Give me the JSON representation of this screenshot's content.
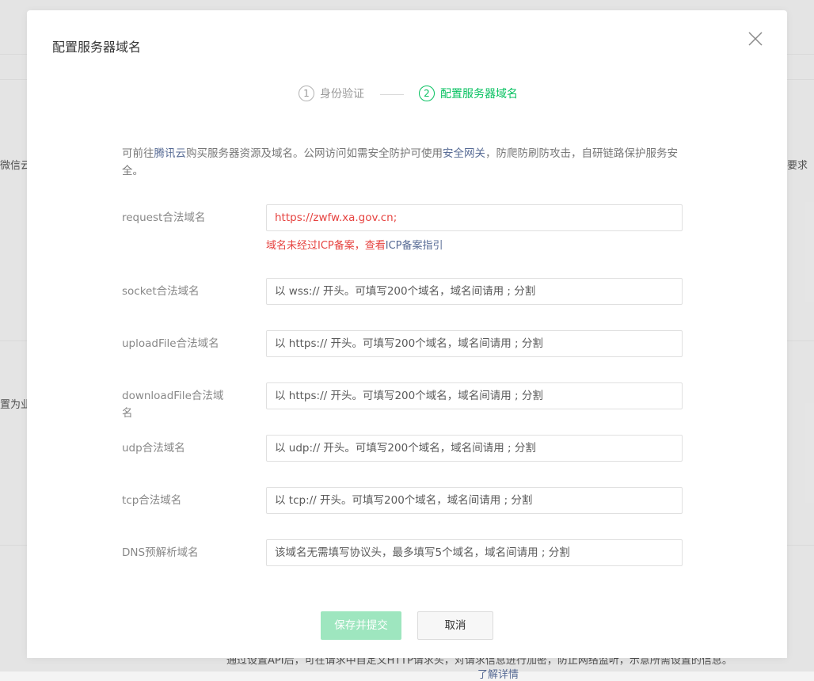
{
  "background": {
    "left_text_1": "微信云",
    "right_text_1": "要求",
    "left_text_2": "置为业务",
    "bottom_text": "通过设置API后，可在请求中自定义HTTP请求头，对请求信息进行加密，防止网络监听，示意所需设置的信息。",
    "bottom_link": "了解详情"
  },
  "dialog": {
    "title": "配置服务器域名",
    "steps": [
      {
        "num": "1",
        "label": "身份验证",
        "state": "done"
      },
      {
        "num": "2",
        "label": "配置服务器域名",
        "state": "active"
      }
    ],
    "description": {
      "part1": "可前往",
      "link1": "腾讯云",
      "part2": "购买服务器资源及域名。公网访问如需安全防护可使用",
      "link2": "安全网关",
      "part3": "，防爬防刷防攻击，自研链路保护服务安全。"
    },
    "fields": [
      {
        "label": "request合法域名",
        "value": "https://zwfw.xa.gov.cn;",
        "placeholder": ""
      },
      {
        "label": "socket合法域名",
        "value": "",
        "placeholder": "以 wss:// 开头。可填写200个域名，域名间请用 ; 分割"
      },
      {
        "label": "uploadFile合法域名",
        "value": "",
        "placeholder": "以 https:// 开头。可填写200个域名，域名间请用 ; 分割"
      },
      {
        "label": "downloadFile合法域名",
        "value": "",
        "placeholder": "以 https:// 开头。可填写200个域名，域名间请用 ; 分割"
      },
      {
        "label": "udp合法域名",
        "value": "",
        "placeholder": "以 udp:// 开头。可填写200个域名，域名间请用 ; 分割"
      },
      {
        "label": "tcp合法域名",
        "value": "",
        "placeholder": "以 tcp:// 开头。可填写200个域名，域名间请用 ; 分割"
      },
      {
        "label": "DNS预解析域名",
        "value": "",
        "placeholder": "该域名无需填写协议头，最多填写5个域名，域名间请用 ; 分割"
      }
    ],
    "error": {
      "text": "域名未经过ICP备案，查看",
      "link": "ICP备案指引"
    },
    "buttons": {
      "submit": "保存并提交",
      "cancel": "取消"
    }
  },
  "colors": {
    "accent": "#07c160",
    "link": "#576b95",
    "error": "#e64340"
  }
}
